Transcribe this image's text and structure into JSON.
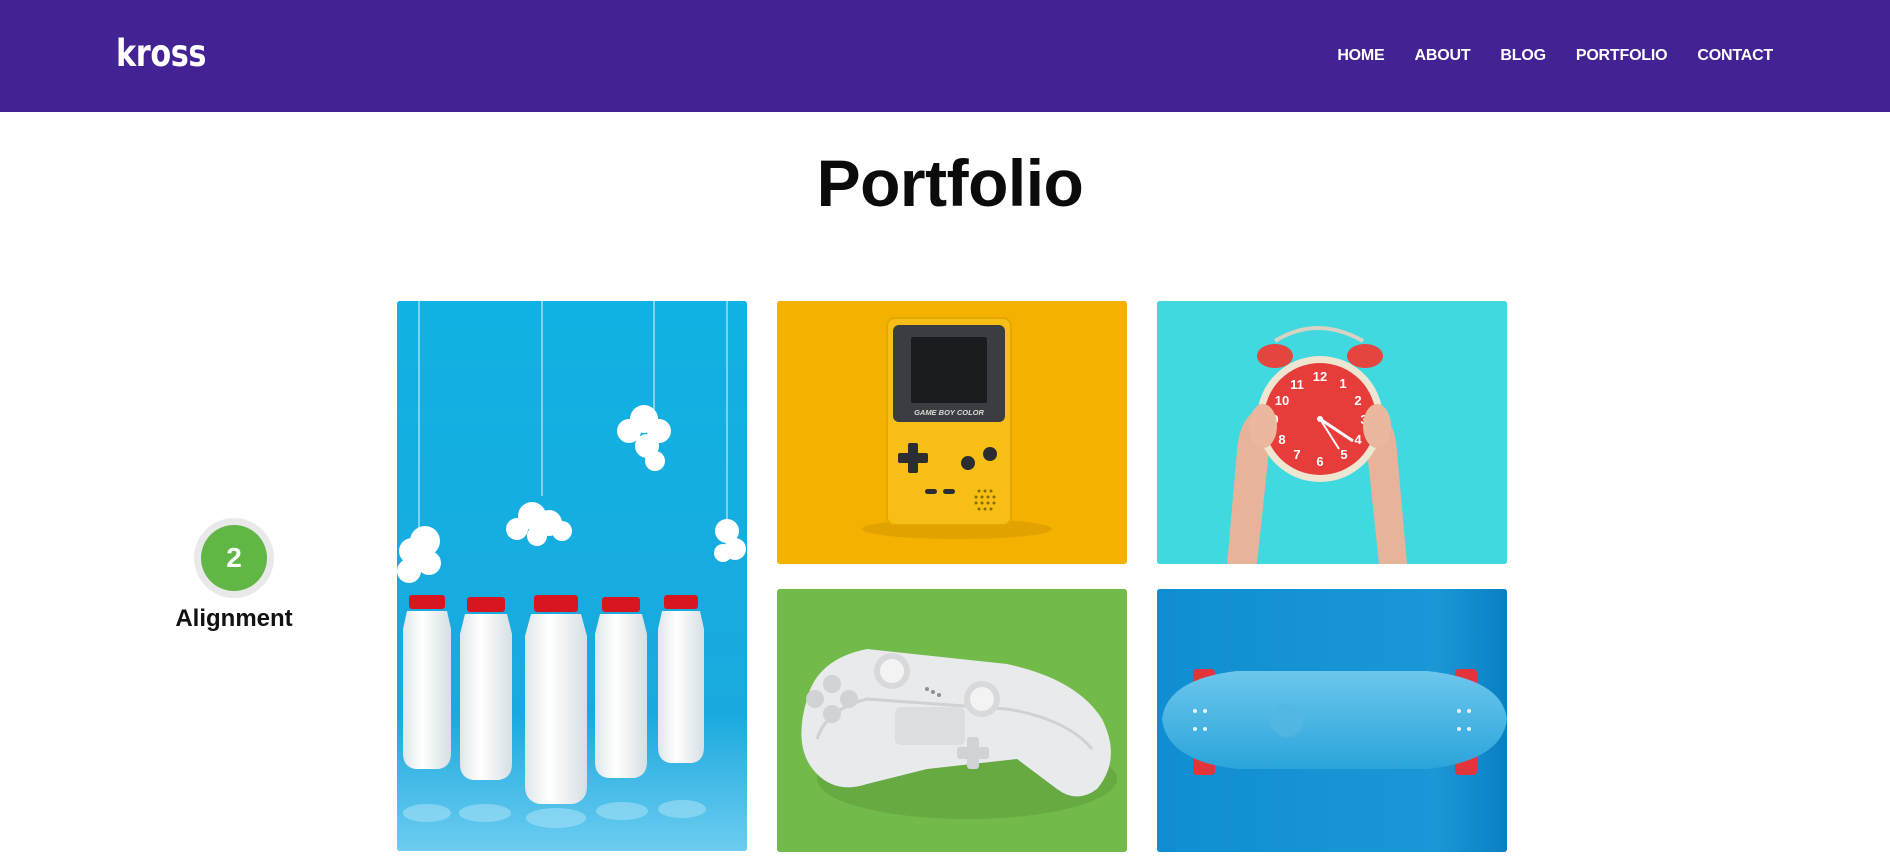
{
  "header": {
    "logo": "kross",
    "nav": [
      "HOME",
      "ABOUT",
      "BLOG",
      "PORTFOLIO",
      "CONTACT"
    ],
    "background_color": "#432293"
  },
  "main": {
    "title": "Portfolio"
  },
  "step": {
    "number": "2",
    "label": "Alignment",
    "color": "#61b745"
  },
  "portfolio": {
    "items": [
      {
        "subject": "milk-bottles-and-clouds",
        "background_color": "#13b5e4"
      },
      {
        "subject": "game-boy-color",
        "background_color": "#f4b100"
      },
      {
        "subject": "alarm-clock",
        "background_color": "#3fd9df"
      },
      {
        "subject": "game-controller",
        "background_color": "#72bb4a"
      },
      {
        "subject": "skateboard",
        "background_color": "#0c8ccf"
      }
    ]
  },
  "gameboy": {
    "brand_text": "GAME BOY COLOR"
  }
}
